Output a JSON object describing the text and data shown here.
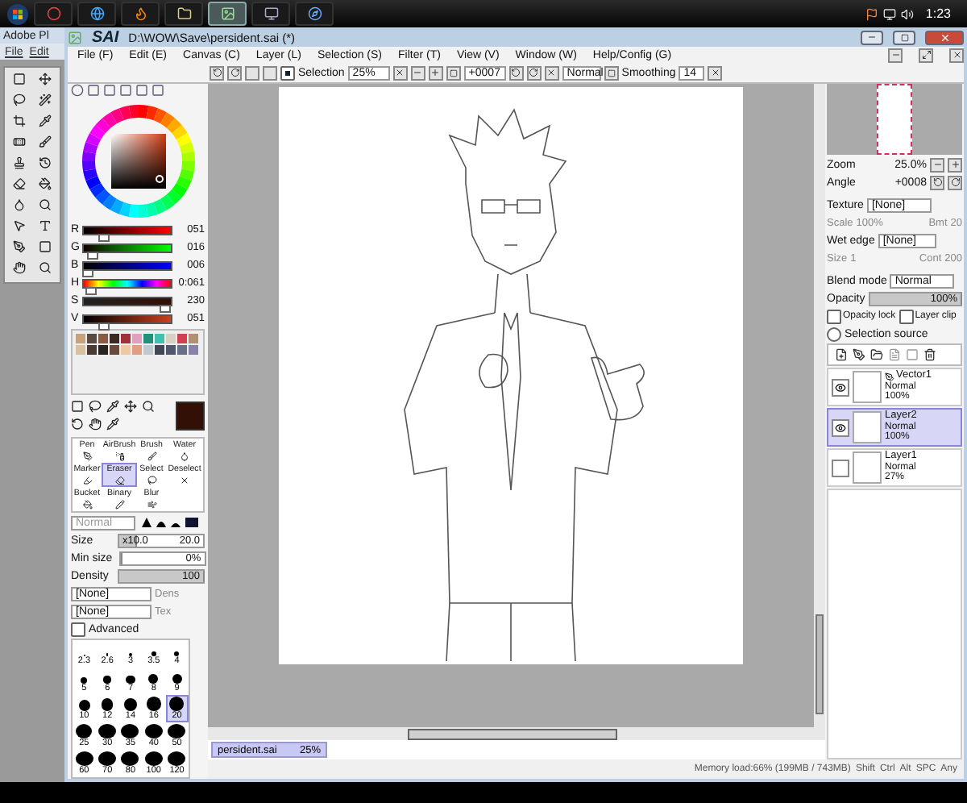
{
  "taskbar": {
    "clock": "1:23"
  },
  "background_window": {
    "title": "Adobe Pl",
    "menu": [
      "File",
      "Edit"
    ]
  },
  "window": {
    "logo": "SAI",
    "title": "D:\\WOW\\Save\\persident.sai (*)"
  },
  "menu": [
    "File (F)",
    "Edit (E)",
    "Canvas (C)",
    "Layer (L)",
    "Selection (S)",
    "Filter (T)",
    "View (V)",
    "Window (W)",
    "Help/Config (G)"
  ],
  "toolbar": {
    "selection": {
      "label": "Selection",
      "checked": true
    },
    "zoom": "25%",
    "angle": "+0007",
    "blend": "Normal",
    "smoothing_label": "Smoothing",
    "smoothing": "14"
  },
  "color_sliders": [
    {
      "kind": "red",
      "label": "R",
      "value": "051",
      "level": 0.2
    },
    {
      "kind": "green",
      "label": "G",
      "value": "016",
      "level": 0.06
    },
    {
      "kind": "blue",
      "label": "B",
      "value": "006",
      "level": 0.03
    },
    {
      "kind": "hue",
      "label": "H",
      "value": "0:061",
      "level": 0.05
    },
    {
      "kind": "saturation",
      "label": "S",
      "value": "230",
      "level": 0.9
    },
    {
      "kind": "value",
      "label": "V",
      "value": "051",
      "level": 0.2
    }
  ],
  "current_color": {
    "color": "#331006"
  },
  "swatches": [
    {
      "color": "#c8a27a"
    },
    {
      "color": "#5a4a42"
    },
    {
      "color": "#8a5a40"
    },
    {
      "color": "#3a2a22"
    },
    {
      "color": "#a0303a"
    },
    {
      "color": "#e0a0c0"
    },
    {
      "color": "#20907a"
    },
    {
      "color": "#40c0b0"
    },
    {
      "color": "#d8d0c0"
    },
    {
      "color": "#d04050"
    },
    {
      "color": "#b09070"
    },
    {
      "color": "#d8c0a0"
    },
    {
      "color": "#4a3a30"
    },
    {
      "color": "#2a2420"
    },
    {
      "color": "#6a4a3a"
    },
    {
      "color": "#f0c8a0"
    },
    {
      "color": "#e0a080"
    },
    {
      "color": "#c0c8d0"
    },
    {
      "color": "#404858"
    },
    {
      "color": "#505870"
    },
    {
      "color": "#687088"
    },
    {
      "color": "#8a80a8"
    }
  ],
  "tools": [
    {
      "label": "Pen",
      "selected": false
    },
    {
      "label": "AirBrush",
      "selected": false
    },
    {
      "label": "Brush",
      "selected": false
    },
    {
      "label": "Water",
      "selected": false
    },
    {
      "label": "Marker",
      "selected": false
    },
    {
      "label": "Eraser",
      "selected": true
    },
    {
      "label": "Select",
      "selected": false
    },
    {
      "label": "Deselect",
      "selected": false
    },
    {
      "label": "Bucket",
      "selected": false
    },
    {
      "label": "Binary",
      "selected": false
    },
    {
      "label": "Blur",
      "selected": false
    }
  ],
  "brush": {
    "mode": "Normal",
    "size_label": "Size",
    "size": {
      "multiplier": "x10.0",
      "value": "20.0",
      "level": 0.2
    },
    "min_size": {
      "label": "Min size",
      "value": "0%",
      "level": 0
    },
    "density": {
      "label": "Density",
      "value": "100",
      "level": 1
    },
    "shape": "[None]",
    "shape_param": "Dens",
    "texture": "[None]",
    "texture_param": "Tex",
    "advanced": {
      "label": "Advanced",
      "checked": false
    }
  },
  "brush_sizes": [
    {
      "label": "2.3",
      "selected": false
    },
    {
      "label": "2.6",
      "selected": false
    },
    {
      "label": "3",
      "selected": false
    },
    {
      "label": "3.5",
      "selected": false
    },
    {
      "label": "4",
      "selected": false
    },
    {
      "label": "5",
      "selected": false
    },
    {
      "label": "6",
      "selected": false
    },
    {
      "label": "7",
      "selected": false
    },
    {
      "label": "8",
      "selected": false
    },
    {
      "label": "9",
      "selected": false
    },
    {
      "label": "10",
      "selected": false
    },
    {
      "label": "12",
      "selected": false
    },
    {
      "label": "14",
      "selected": false
    },
    {
      "label": "16",
      "selected": false
    },
    {
      "label": "20",
      "selected": true
    },
    {
      "label": "25",
      "selected": false
    },
    {
      "label": "30",
      "selected": false
    },
    {
      "label": "35",
      "selected": false
    },
    {
      "label": "40",
      "selected": false
    },
    {
      "label": "50",
      "selected": false
    },
    {
      "label": "60",
      "selected": false
    },
    {
      "label": "70",
      "selected": false
    },
    {
      "label": "80",
      "selected": false
    },
    {
      "label": "100",
      "selected": false
    },
    {
      "label": "120",
      "selected": false
    }
  ],
  "navigator": {
    "zoom_label": "Zoom",
    "zoom": "25.0%",
    "angle_label": "Angle",
    "angle": "+0008"
  },
  "texture": {
    "label": "Texture",
    "value": "[None]",
    "scale_label": "Scale",
    "scale": "100%",
    "amount_label": "Bmt",
    "amount": "20"
  },
  "wet_edge": {
    "label": "Wet edge",
    "value": "[None]",
    "size_label": "Size",
    "size": "1",
    "cont_label": "Cont",
    "cont": "200"
  },
  "layer_props": {
    "blend_label": "Blend mode",
    "blend": "Normal",
    "opacity": {
      "label": "Opacity",
      "value": "100%",
      "level": 1
    },
    "checks": [
      {
        "label": "Opacity lock",
        "checked": false
      },
      {
        "label": "Layer clip",
        "checked": false
      }
    ],
    "selection_source": {
      "label": "Selection source",
      "selected": false
    }
  },
  "layers": [
    {
      "kind": "vector",
      "name": "Vector1",
      "mode": "Normal",
      "opacity": "100%",
      "visible": true,
      "selected": false
    },
    {
      "kind": "raster",
      "name": "Layer2",
      "mode": "Normal",
      "opacity": "100%",
      "visible": true,
      "selected": true
    },
    {
      "kind": "raster",
      "name": "Layer1",
      "mode": "Normal",
      "opacity": "27%",
      "visible": false,
      "selected": false
    }
  ],
  "document_tab": {
    "name": "persident.sai",
    "zoom": "25%",
    "selected": true
  },
  "status": {
    "memory": "Memory load:66% (199MB / 743MB)",
    "keys": [
      "Shift",
      "Ctrl",
      "Alt",
      "SPC",
      "Any"
    ]
  }
}
